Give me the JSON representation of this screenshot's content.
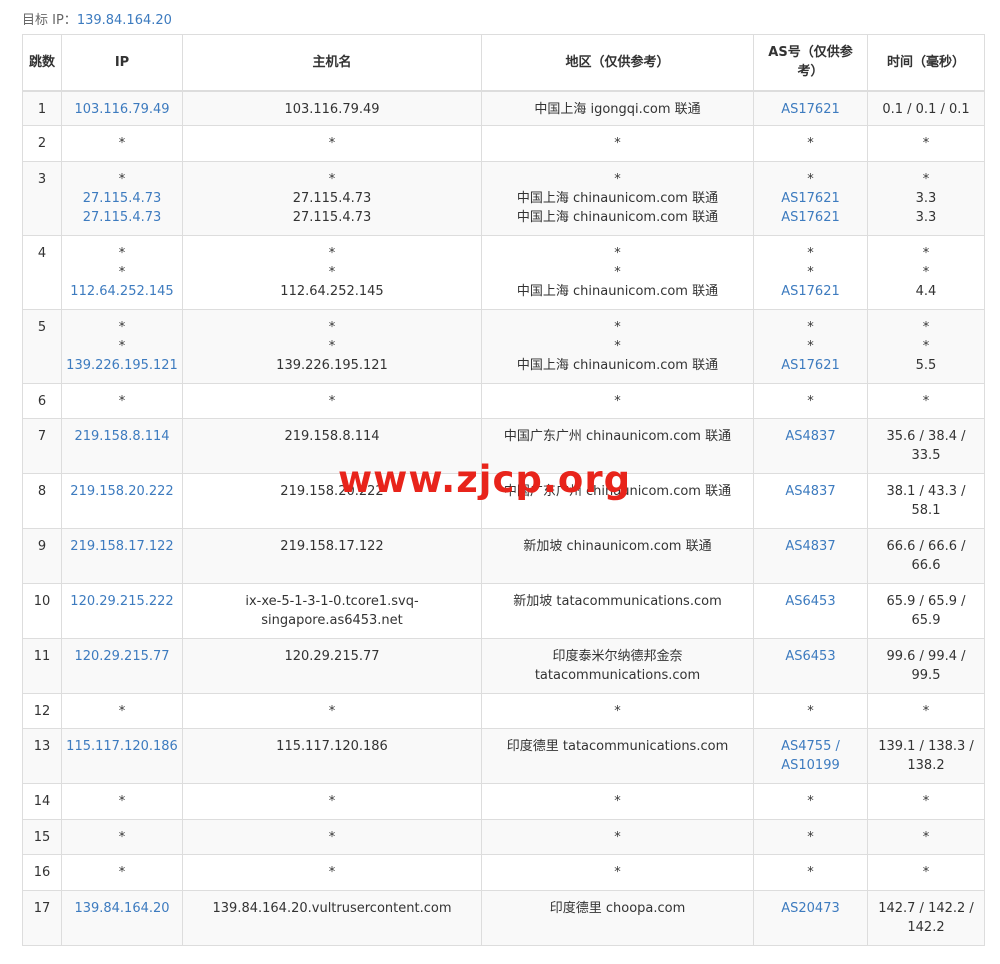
{
  "target": {
    "label": "目标 IP：",
    "ip": "139.84.164.20"
  },
  "columns": {
    "hop": "跳数",
    "ip": "IP",
    "host": "主机名",
    "region": "地区（仅供参考）",
    "asn": "AS号（仅供参考）",
    "time": "时间（毫秒）"
  },
  "rows": [
    {
      "hop": "1",
      "ip": [
        "103.116.79.49"
      ],
      "host": [
        "103.116.79.49"
      ],
      "region": [
        "中国上海 igongqi.com 联通"
      ],
      "asn": [
        "AS17621"
      ],
      "time": [
        "0.1 / 0.1 / 0.1"
      ]
    },
    {
      "hop": "2",
      "ip": [
        "*"
      ],
      "host": [
        "*"
      ],
      "region": [
        "*"
      ],
      "asn": [
        "*"
      ],
      "time": [
        "*"
      ]
    },
    {
      "hop": "3",
      "ip": [
        "*",
        "27.115.4.73",
        "27.115.4.73"
      ],
      "host": [
        "*",
        "27.115.4.73",
        "27.115.4.73"
      ],
      "region": [
        "*",
        "中国上海 chinaunicom.com 联通",
        "中国上海 chinaunicom.com 联通"
      ],
      "asn": [
        "*",
        "AS17621",
        "AS17621"
      ],
      "time": [
        "*",
        "3.3",
        "3.3"
      ]
    },
    {
      "hop": "4",
      "ip": [
        "*",
        "*",
        "112.64.252.145"
      ],
      "host": [
        "*",
        "*",
        "112.64.252.145"
      ],
      "region": [
        "*",
        "*",
        "中国上海 chinaunicom.com 联通"
      ],
      "asn": [
        "*",
        "*",
        "AS17621"
      ],
      "time": [
        "*",
        "*",
        "4.4"
      ]
    },
    {
      "hop": "5",
      "ip": [
        "*",
        "*",
        "139.226.195.121"
      ],
      "host": [
        "*",
        "*",
        "139.226.195.121"
      ],
      "region": [
        "*",
        "*",
        "中国上海 chinaunicom.com 联通"
      ],
      "asn": [
        "*",
        "*",
        "AS17621"
      ],
      "time": [
        "*",
        "*",
        "5.5"
      ]
    },
    {
      "hop": "6",
      "ip": [
        "*"
      ],
      "host": [
        "*"
      ],
      "region": [
        "*"
      ],
      "asn": [
        "*"
      ],
      "time": [
        "*"
      ]
    },
    {
      "hop": "7",
      "ip": [
        "219.158.8.114"
      ],
      "host": [
        "219.158.8.114"
      ],
      "region": [
        "中国广东广州 chinaunicom.com 联通"
      ],
      "asn": [
        "AS4837"
      ],
      "time": [
        "35.6 / 38.4 /",
        "33.5"
      ]
    },
    {
      "hop": "8",
      "ip": [
        "219.158.20.222"
      ],
      "host": [
        "219.158.20.222"
      ],
      "region": [
        "中国广东广州 chinaunicom.com 联通"
      ],
      "asn": [
        "AS4837"
      ],
      "time": [
        "38.1 / 43.3 /",
        "58.1"
      ]
    },
    {
      "hop": "9",
      "ip": [
        "219.158.17.122"
      ],
      "host": [
        "219.158.17.122"
      ],
      "region": [
        "新加坡 chinaunicom.com 联通"
      ],
      "asn": [
        "AS4837"
      ],
      "time": [
        "66.6 / 66.6 /",
        "66.6"
      ]
    },
    {
      "hop": "10",
      "ip": [
        "120.29.215.222"
      ],
      "host": [
        "ix-xe-5-1-3-1-0.tcore1.svq-",
        "singapore.as6453.net"
      ],
      "region": [
        "新加坡 tatacommunications.com"
      ],
      "asn": [
        "AS6453"
      ],
      "time": [
        "65.9 / 65.9 /",
        "65.9"
      ]
    },
    {
      "hop": "11",
      "ip": [
        "120.29.215.77"
      ],
      "host": [
        "120.29.215.77"
      ],
      "region": [
        "印度泰米尔纳德邦金奈",
        "tatacommunications.com"
      ],
      "asn": [
        "AS6453"
      ],
      "time": [
        "99.6 / 99.4 /",
        "99.5"
      ]
    },
    {
      "hop": "12",
      "ip": [
        "*"
      ],
      "host": [
        "*"
      ],
      "region": [
        "*"
      ],
      "asn": [
        "*"
      ],
      "time": [
        "*"
      ]
    },
    {
      "hop": "13",
      "ip": [
        "115.117.120.186"
      ],
      "host": [
        "115.117.120.186"
      ],
      "region": [
        "印度德里 tatacommunications.com"
      ],
      "asn": [
        "AS4755 /",
        "AS10199"
      ],
      "time": [
        "139.1 / 138.3 /",
        "138.2"
      ]
    },
    {
      "hop": "14",
      "ip": [
        "*"
      ],
      "host": [
        "*"
      ],
      "region": [
        "*"
      ],
      "asn": [
        "*"
      ],
      "time": [
        "*"
      ]
    },
    {
      "hop": "15",
      "ip": [
        "*"
      ],
      "host": [
        "*"
      ],
      "region": [
        "*"
      ],
      "asn": [
        "*"
      ],
      "time": [
        "*"
      ]
    },
    {
      "hop": "16",
      "ip": [
        "*"
      ],
      "host": [
        "*"
      ],
      "region": [
        "*"
      ],
      "asn": [
        "*"
      ],
      "time": [
        "*"
      ]
    },
    {
      "hop": "17",
      "ip": [
        "139.84.164.20"
      ],
      "host": [
        "139.84.164.20.vultrusercontent.com"
      ],
      "region": [
        "印度德里 choopa.com"
      ],
      "asn": [
        "AS20473"
      ],
      "time": [
        "142.7 / 142.2 /",
        "142.2"
      ]
    }
  ],
  "watermark": "www.zjcp.org",
  "colors": {
    "link": "#3d7bbf",
    "watermark": "#e8241b",
    "border": "#dddddd",
    "stripe": "#f9f9f9"
  }
}
